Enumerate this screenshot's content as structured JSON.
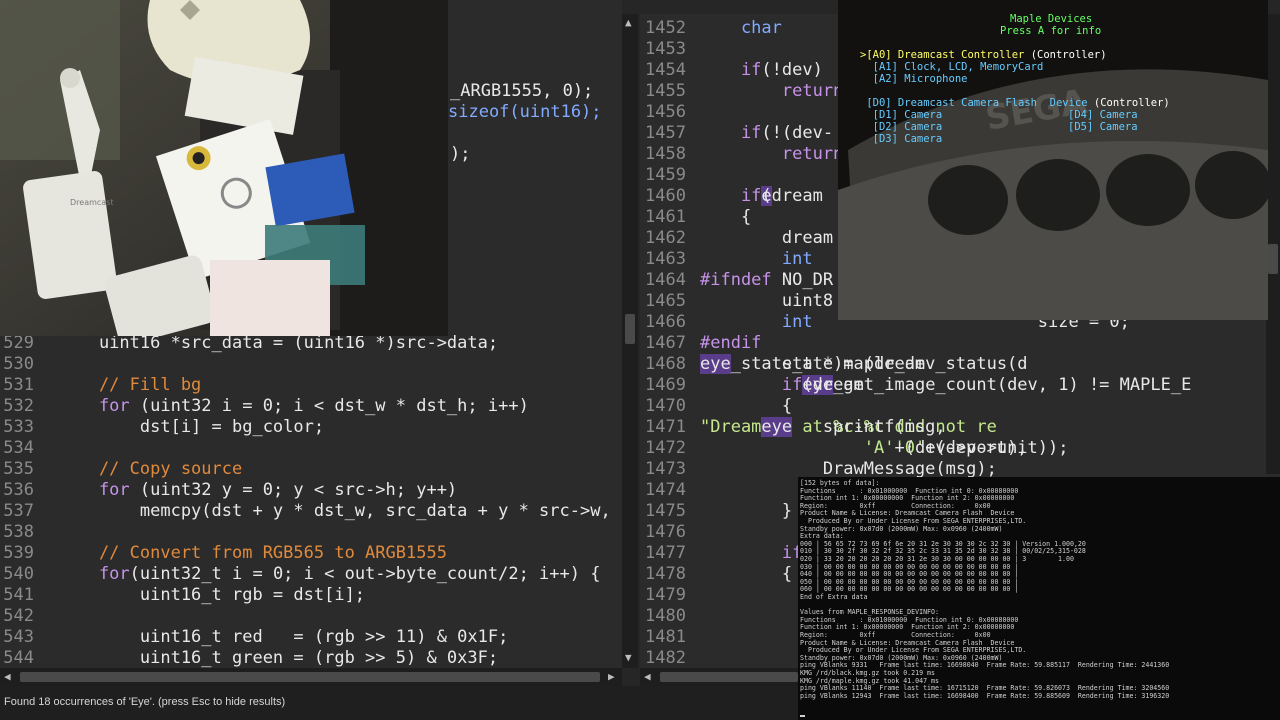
{
  "left_editor": {
    "top_fragments": [
      {
        "text": "_ARGB1555, 0);"
      },
      {
        "text": "sizeof(uint16);"
      },
      {
        "text": ");"
      }
    ],
    "lines": [
      {
        "n": "529",
        "parts": [
          {
            "c": "tx",
            "t": "    uint16 *src_data = (uint16 *)src->data;"
          }
        ]
      },
      {
        "n": "530",
        "parts": []
      },
      {
        "n": "531",
        "parts": [
          {
            "c": "cm",
            "t": "    // Fill bg"
          }
        ]
      },
      {
        "n": "532",
        "parts": [
          {
            "c": "kw",
            "t": "    for"
          },
          {
            "c": "tx",
            "t": " (uint32 i = 0; i < dst_w * dst_h; i++)"
          }
        ]
      },
      {
        "n": "533",
        "parts": [
          {
            "c": "tx",
            "t": "        dst[i] = bg_color;"
          }
        ]
      },
      {
        "n": "534",
        "parts": []
      },
      {
        "n": "535",
        "parts": [
          {
            "c": "cm",
            "t": "    // Copy source"
          }
        ]
      },
      {
        "n": "536",
        "parts": [
          {
            "c": "kw",
            "t": "    for"
          },
          {
            "c": "tx",
            "t": " (uint32 y = 0; y < src->h; y++)"
          }
        ]
      },
      {
        "n": "537",
        "parts": [
          {
            "c": "tx",
            "t": "        memcpy(dst + y * dst_w, src_data + y * src->w,"
          }
        ]
      },
      {
        "n": "538",
        "parts": []
      },
      {
        "n": "539",
        "parts": [
          {
            "c": "cm",
            "t": "    // Convert from RGB565 to ARGB1555"
          }
        ]
      },
      {
        "n": "540",
        "parts": [
          {
            "c": "kw",
            "t": "    for"
          },
          {
            "c": "tx",
            "t": "(uint32_t i = 0; i < out->byte_count/2; i++) {"
          }
        ]
      },
      {
        "n": "541",
        "parts": [
          {
            "c": "tx",
            "t": "        uint16_t rgb = dst[i];"
          }
        ]
      },
      {
        "n": "542",
        "parts": []
      },
      {
        "n": "543",
        "parts": [
          {
            "c": "tx",
            "t": "        uint16_t red   = (rgb >> 11) & 0x1F;"
          }
        ]
      },
      {
        "n": "544",
        "parts": [
          {
            "c": "tx",
            "t": "        uint16_t green = (rgb >> 5) & 0x3F;"
          }
        ]
      }
    ]
  },
  "right_editor": {
    "lines": [
      {
        "n": "1452",
        "parts": [
          {
            "c": "ty",
            "t": "    char"
          },
          {
            "c": "tx",
            "t": "      ms"
          }
        ]
      },
      {
        "n": "1453",
        "parts": []
      },
      {
        "n": "1454",
        "parts": [
          {
            "c": "kw",
            "t": "    if"
          },
          {
            "c": "tx",
            "t": "(!dev)"
          }
        ]
      },
      {
        "n": "1455",
        "parts": [
          {
            "c": "kw",
            "t": "        return"
          }
        ]
      },
      {
        "n": "1456",
        "parts": []
      },
      {
        "n": "1457",
        "parts": [
          {
            "c": "kw",
            "t": "    if"
          },
          {
            "c": "tx",
            "t": "(!(dev-"
          }
        ]
      },
      {
        "n": "1458",
        "parts": [
          {
            "c": "kw",
            "t": "        return"
          }
        ]
      },
      {
        "n": "1459",
        "parts": []
      },
      {
        "n": "1460",
        "parts": [
          {
            "c": "kw",
            "t": "    if"
          },
          {
            "c": "tx",
            "t": "(dream"
          },
          {
            "c": "hl",
            "t": "e"
          }
        ]
      },
      {
        "n": "1461",
        "parts": [
          {
            "c": "tx",
            "t": "    {"
          }
        ]
      },
      {
        "n": "1462",
        "parts": [
          {
            "c": "tx",
            "t": "        dream"
          }
        ]
      },
      {
        "n": "1463",
        "parts": [
          {
            "c": "ty",
            "t": "        int"
          }
        ]
      },
      {
        "n": "1464",
        "parts": [
          {
            "c": "kw",
            "t": "#ifndef"
          },
          {
            "c": "tx",
            "t": " NO_DR"
          }
        ]
      },
      {
        "n": "1465",
        "parts": [
          {
            "c": "tx",
            "t": "        uint8"
          }
        ]
      },
      {
        "n": "1466",
        "parts": [
          {
            "c": "ty",
            "t": "        int"
          },
          {
            "c": "tx",
            "t": "                      size = 0;"
          }
        ]
      },
      {
        "n": "1467",
        "parts": [
          {
            "c": "kw",
            "t": "#endif"
          }
        ]
      },
      {
        "n": "1468",
        "parts": [
          {
            "c": "tx",
            "t": "        state = (dream"
          },
          {
            "c": "hl",
            "t": "eye"
          },
          {
            "c": "tx",
            "t": "_state_t *)maple_dev_status(d"
          }
        ]
      },
      {
        "n": "1469",
        "parts": [
          {
            "c": "kw",
            "t": "        if"
          },
          {
            "c": "tx",
            "t": "(dream"
          },
          {
            "c": "hl",
            "t": "eye"
          },
          {
            "c": "tx",
            "t": "_get_image_count(dev, 1) != MAPLE_E"
          }
        ]
      },
      {
        "n": "1470",
        "parts": [
          {
            "c": "tx",
            "t": "        {"
          }
        ]
      },
      {
        "n": "1471",
        "parts": [
          {
            "c": "tx",
            "t": "            sprintf(msg, "
          },
          {
            "c": "st",
            "t": "\"Dream"
          },
          {
            "c": "hl",
            "t": "eye"
          },
          {
            "c": "st",
            "t": " at %c-%c did not re"
          }
        ]
      },
      {
        "n": "1472",
        "parts": [
          {
            "c": "st",
            "t": "                'A'"
          },
          {
            "c": "tx",
            "t": "+(dev->port), "
          },
          {
            "c": "st",
            "t": "'0'"
          },
          {
            "c": "tx",
            "t": "+(dev->unit));"
          }
        ]
      },
      {
        "n": "1473",
        "parts": [
          {
            "c": "tx",
            "t": "            DrawMessage(msg);"
          }
        ]
      },
      {
        "n": "1474",
        "parts": []
      },
      {
        "n": "1475",
        "parts": [
          {
            "c": "tx",
            "t": "        }"
          }
        ]
      },
      {
        "n": "1476",
        "parts": []
      },
      {
        "n": "1477",
        "parts": [
          {
            "c": "kw",
            "t": "        if"
          }
        ]
      },
      {
        "n": "1478",
        "parts": [
          {
            "c": "tx",
            "t": "        {"
          }
        ]
      },
      {
        "n": "1479",
        "parts": []
      },
      {
        "n": "1480",
        "parts": []
      },
      {
        "n": "1481",
        "parts": []
      },
      {
        "n": "1482",
        "parts": []
      }
    ]
  },
  "status_bar": {
    "text": "Found 18 occurrences of 'Eye'. (press Esc to hide results)"
  },
  "maple_overlay": {
    "title": "Maple Devices",
    "subtitle": "Press A for info",
    "entries": [
      {
        "text": ">[A0] Dreamcast Controller",
        "suffix": " (Controller)",
        "color": "#ffff66"
      },
      {
        "text": "  [A1] Clock, LCD, MemoryCard",
        "suffix": "",
        "color": "#66ccff"
      },
      {
        "text": "  [A2] Microphone",
        "suffix": "",
        "color": "#66ccff"
      },
      {
        "text": " [D0] Dreamcast Camera Flash  Device",
        "suffix": " (Controller)",
        "color": "#66ccff"
      },
      {
        "text": "  [D1] Camera",
        "suffix": "",
        "color": "#66ccff"
      },
      {
        "text": "  [D2] Camera",
        "suffix": "",
        "color": "#66ccff"
      },
      {
        "text": "  [D3] Camera",
        "suffix": "",
        "color": "#66ccff"
      },
      {
        "text": "[D4] Camera",
        "suffix": "",
        "color": "#66ccff"
      },
      {
        "text": "[D5] Camera",
        "suffix": "",
        "color": "#66ccff"
      }
    ],
    "console_logo": "SEGA"
  },
  "terminal": {
    "lines": [
      "[152 bytes of data]:",
      "Functions      : 0x01000000  Function int 0: 0x00080000",
      "Function int 1: 0x00000000  Function int 2: 0x00000000",
      "Region:        0xff         Connection:     0x00",
      "Product Name & License: Dreamcast Camera Flash  Device",
      "  Produced By or Under License From SEGA ENTERPRISES,LTD.",
      "Standby power: 0x07d0 (2000mW) Max: 0x0960 (2400mW)",
      "Extra data:",
      "000 | 56 65 72 73 69 6f 6e 20 31 2e 30 30 30 2c 32 30 | Version 1.000,20",
      "010 | 30 30 2f 30 32 2f 32 35 2c 33 31 35 2d 30 32 38 | 00/02/25,315-028",
      "020 | 33 20 20 20 20 20 20 31 2e 30 30 00 00 00 00 00 | 3        1.00",
      "030 | 00 00 00 00 00 00 00 00 00 00 00 00 00 00 00 00 |",
      "040 | 00 00 00 00 00 00 00 00 00 00 00 00 00 00 00 00 |",
      "050 | 00 00 00 00 00 00 00 00 00 00 00 00 00 00 00 00 |",
      "060 | 00 00 00 00 00 00 00 00 00 00 00 00 00 00 00 00 |",
      "End of Extra data",
      "",
      "Values from MAPLE_RESPONSE_DEVINFO:",
      "Functions      : 0x01000000  Function int 0: 0x00080000",
      "Function int 1: 0x00000000  Function int 2: 0x00000000",
      "Region:        0xff         Connection:     0x00",
      "Product Name & License: Dreamcast Camera Flash  Device",
      "  Produced By or Under License From SEGA ENTERPRISES,LTD.",
      "Standby power: 0x07d0 (2000mW) Max: 0x0960 (2400mW)",
      "ping VBlanks 9331   Frame last time: 16698040  Frame Rate: 59.885117  Rendering Time: 2441360",
      "KMG /rd/black.kmg.gz took 0.219 ms",
      "KMG /rd/maple.kmg.gz took 41.047 ms",
      "ping VBlanks 11140  Frame last time: 16715120  Frame Rate: 59.826073  Rendering Time: 3204560",
      "ping VBlanks 12943  Frame last time: 16698400  Frame Rate: 59.885609  Rendering Time: 3196320"
    ]
  },
  "photo": {
    "dreamcast_label": "Dreamcast"
  }
}
